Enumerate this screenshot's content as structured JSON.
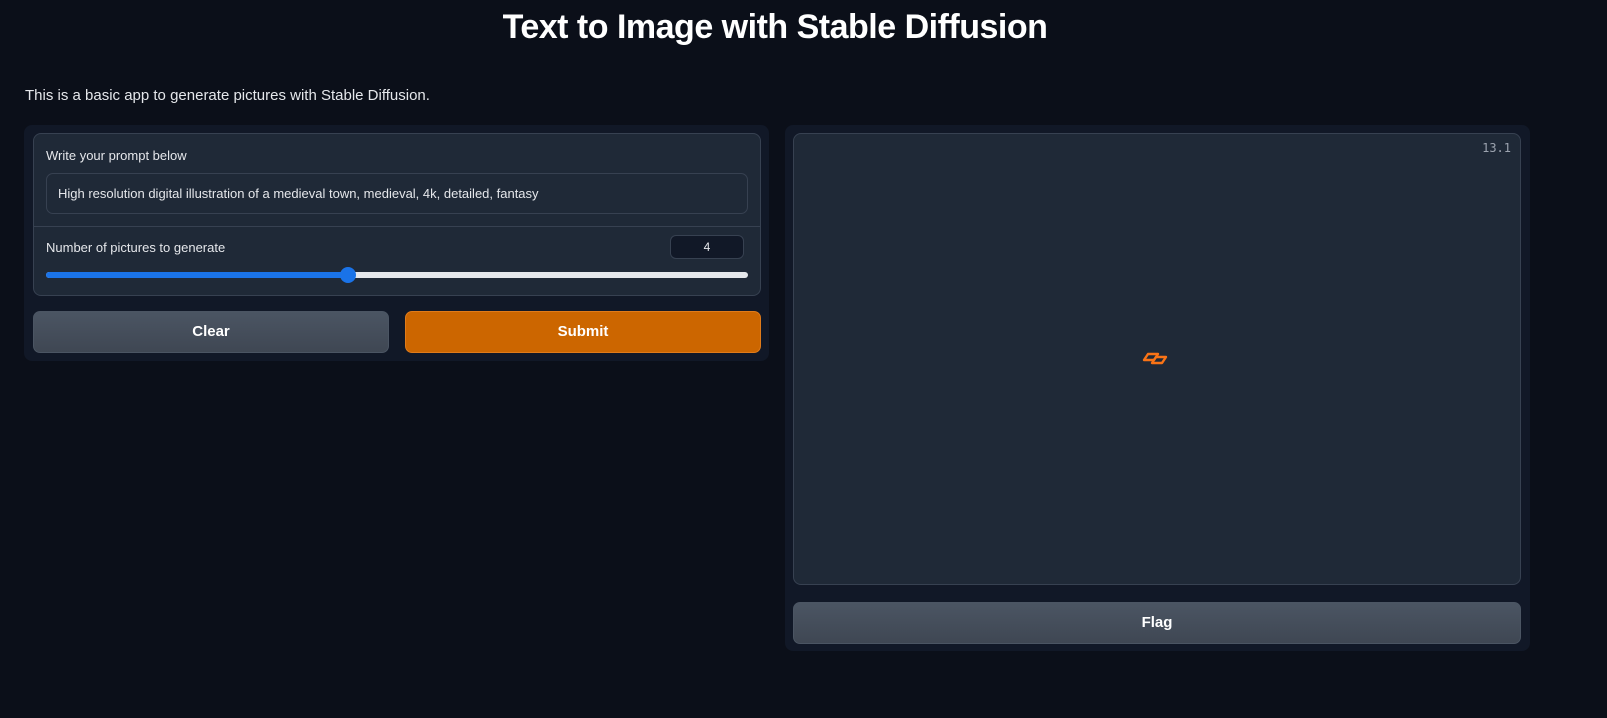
{
  "header": {
    "title": "Text to Image with Stable Diffusion",
    "description": "This is a basic app to generate pictures with Stable Diffusion."
  },
  "form": {
    "prompt_label": "Write your prompt below",
    "prompt_value": "High resolution digital illustration of a medieval town, medieval, 4k, detailed, fantasy",
    "slider_label": "Number of pictures to generate",
    "slider_value": "4",
    "slider_fraction": 0.43
  },
  "buttons": {
    "clear": "Clear",
    "submit": "Submit",
    "flag": "Flag"
  },
  "output": {
    "timer": "13.1",
    "loader_icon": "loading-spinner-icon"
  },
  "colors": {
    "background": "#0b0f19",
    "panel": "#111827",
    "block": "#1f2937",
    "accent_orange": "#cc6600",
    "slider_blue": "#1a73e8"
  }
}
